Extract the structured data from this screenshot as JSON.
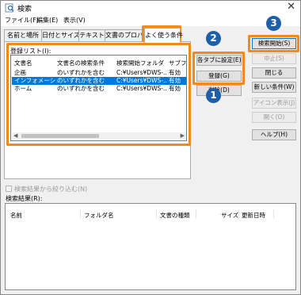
{
  "window": {
    "title": "検索",
    "close": "✕"
  },
  "menu": [
    {
      "label": "ファイル(F)"
    },
    {
      "label": "編集(E)"
    },
    {
      "label": "表示(V)"
    }
  ],
  "tabs": [
    {
      "label": "名前と場所"
    },
    {
      "label": "日付とサイズ"
    },
    {
      "label": "テキスト"
    },
    {
      "label": "文書のプロパティ"
    },
    {
      "label": "よく使う条件"
    }
  ],
  "registry": {
    "label": "登録リスト(I):",
    "columns": [
      "文書名",
      "文書名の検索条件",
      "検索開始フォルダ",
      "サブフォル"
    ],
    "rows": [
      {
        "name": "企画",
        "cond": "のいずれかを含む",
        "folder": "C:¥Users¥DWS-...",
        "sub": "有効",
        "selected": false
      },
      {
        "name": "インフォメーション",
        "cond": "のいずれかを含む",
        "folder": "C:¥Users¥DWS-...",
        "sub": "有効",
        "selected": true
      },
      {
        "name": "ホーム",
        "cond": "のいずれかを含む",
        "folder": "C:¥Users¥DWS-...",
        "sub": "有効",
        "selected": false
      }
    ]
  },
  "middle_buttons": {
    "set_all": "各タブに設定(E)",
    "register": "登録(G)",
    "delete": "削除(D)"
  },
  "right_buttons": {
    "start": "検索開始(S)",
    "stop": "中止(S)",
    "close": "閉じる",
    "new": "新しい条件(W)",
    "icon_view": "アイコン表示(J)",
    "open": "開く(O)",
    "help": "ヘルプ(H)"
  },
  "narrow": {
    "label": "検索結果から絞り込む(N)"
  },
  "results": {
    "label": "検索結果(R):",
    "columns": [
      "名前",
      "フォルダ名",
      "文書の種類",
      "サイズ",
      "更新日時"
    ]
  },
  "callouts": [
    "1",
    "2",
    "3"
  ],
  "colors": {
    "highlight": "#f08a1e",
    "badge": "#1e5fa8",
    "selection": "#0078d7"
  }
}
